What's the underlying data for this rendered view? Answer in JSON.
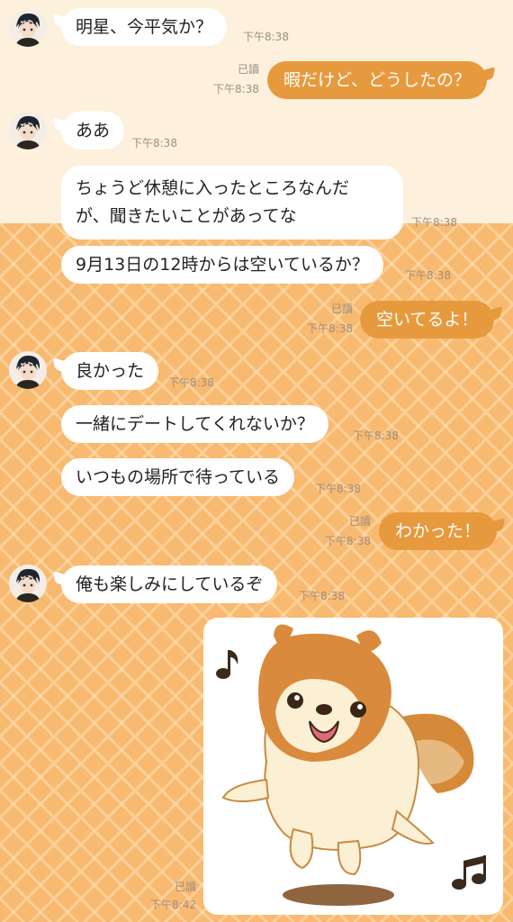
{
  "messages": [
    {
      "text": "明星、今平気か？",
      "time": "下午8:38"
    },
    {
      "text": "暇だけど、どうしたの？",
      "read": "已讀",
      "time": "下午8:38"
    },
    {
      "text": "ああ",
      "time": "下午8:38"
    },
    {
      "line1": "ちょうど休憩に入ったところなんだ",
      "line2": "が、聞きたいことがあってな",
      "time": "下午8:38"
    },
    {
      "text": "9月13日の12時からは空いているか？",
      "time": "下午8:38"
    },
    {
      "text": "空いてるよ！",
      "read": "已讀",
      "time": "下午8:38"
    },
    {
      "text": "良かった",
      "time": "下午8:38"
    },
    {
      "text": "一緒にデートしてくれないか？",
      "time": "下午8:38"
    },
    {
      "text": "いつもの場所で待っている",
      "time": "下午8:38"
    },
    {
      "text": "わかった！",
      "read": "已讀",
      "time": "下午8:38"
    },
    {
      "text": "俺も楽しみにしているぞ",
      "time": "下午8:38"
    },
    {
      "read": "已讀",
      "time": "下午8:42"
    }
  ],
  "colors": {
    "background_top": "#fdf1dd",
    "background_pattern": "#f8b970",
    "outgoing_bubble": "#e79a3d",
    "incoming_bubble": "#ffffff",
    "timestamp": "#9c8f82"
  },
  "icons": {
    "sticker": "pomeranian-dog-sticker",
    "avatar": "contact-avatar"
  }
}
